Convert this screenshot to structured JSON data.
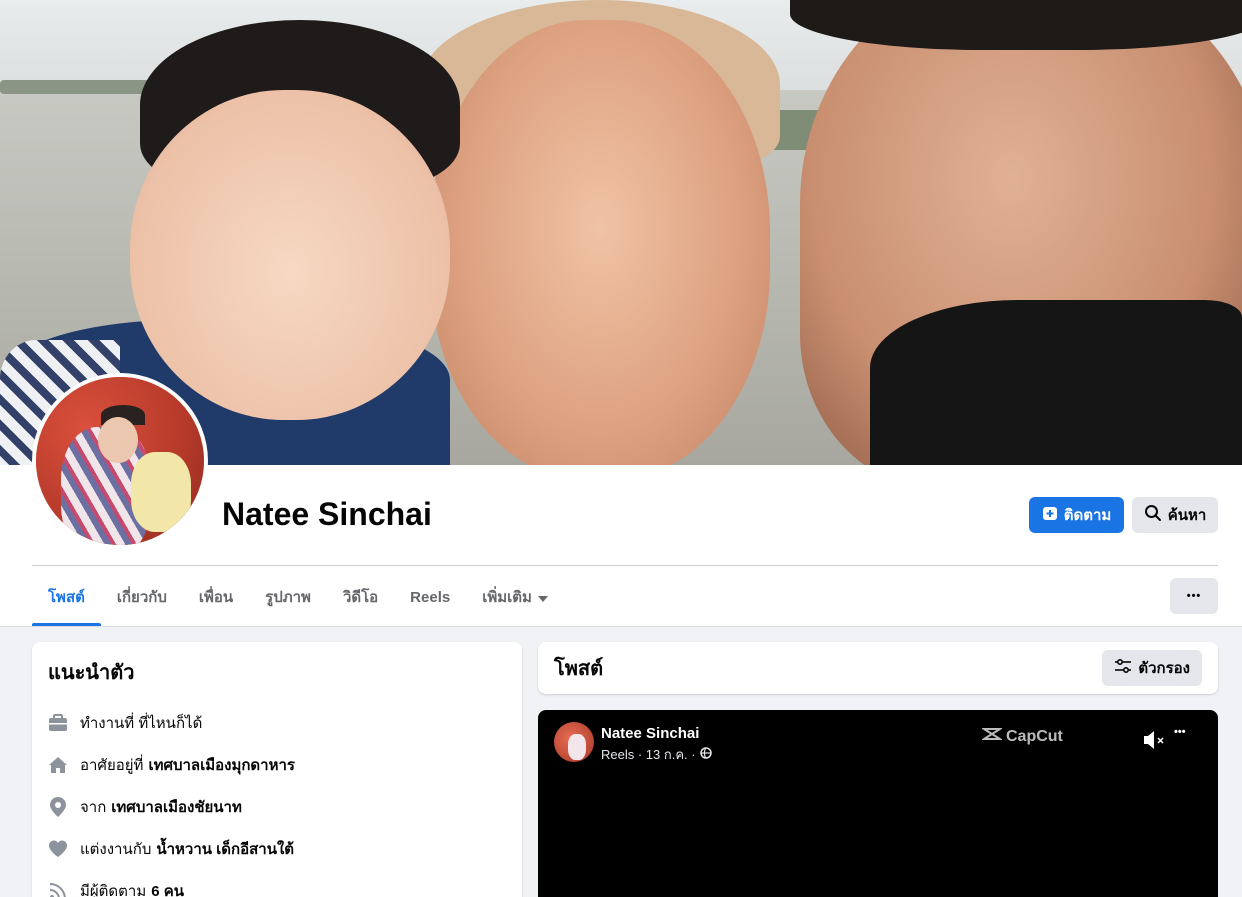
{
  "profile": {
    "name": "Natee Sinchai"
  },
  "actions": {
    "follow_label": "ติดตาม",
    "search_label": "ค้นหา",
    "more_label": "•••"
  },
  "tabs": [
    {
      "label": "โพสต์"
    },
    {
      "label": "เกี่ยวกับ"
    },
    {
      "label": "เพื่อน"
    },
    {
      "label": "รูปภาพ"
    },
    {
      "label": "วิดีโอ"
    },
    {
      "label": "Reels"
    },
    {
      "label": "เพิ่มเติม"
    }
  ],
  "intro": {
    "title": "แนะนำตัว",
    "rows": [
      {
        "icon": "briefcase-icon",
        "prefix": "ทำงานที่ ที่ไหนก็ได้",
        "value": ""
      },
      {
        "icon": "home-icon",
        "prefix": "อาศัยอยู่ที่",
        "value": "เทศบาลเมืองมุกดาหาร"
      },
      {
        "icon": "location-pin-icon",
        "prefix": "จาก",
        "value": "เทศบาลเมืองชัยนาท"
      },
      {
        "icon": "heart-icon",
        "prefix": "แต่งงานกับ",
        "value": "น้ำหวาน เด็กอีสานใต้"
      },
      {
        "icon": "rss-icon",
        "prefix": "มีผู้ติดตาม",
        "value": "6 คน"
      }
    ]
  },
  "posts": {
    "title": "โพสต์",
    "filter_label": "ตัวกรอง"
  },
  "video_post": {
    "author": "Natee Sinchai",
    "meta": "Reels · 13 ก.ค. ·",
    "watermark": "CapCut"
  },
  "colors": {
    "accent": "#1b74e4",
    "button_grey": "#e4e6eb",
    "page_bg": "#f0f2f5"
  }
}
